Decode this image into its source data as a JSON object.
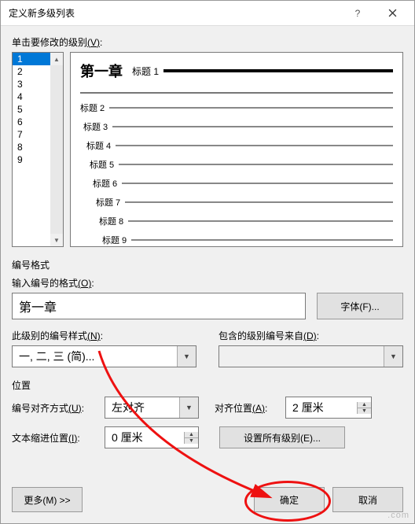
{
  "window": {
    "title": "定义新多级列表"
  },
  "sections": {
    "level_list_label": "单击要修改的级别",
    "level_list_hotkey": "(V)",
    "number_format_label": "编号格式",
    "enter_format_label": "输入编号的格式",
    "enter_format_hotkey": "(O)",
    "style_label": "此级别的编号样式",
    "style_hotkey": "(N)",
    "include_label": "包含的级别编号来自",
    "include_hotkey": "(D)",
    "position_label": "位置",
    "align_label": "编号对齐方式",
    "align_hotkey": "(U)",
    "align_pos_label": "对齐位置",
    "align_pos_hotkey": "(A)",
    "indent_label": "文本缩进位置",
    "indent_hotkey": "(I)"
  },
  "level_list": {
    "items": [
      "1",
      "2",
      "3",
      "4",
      "5",
      "6",
      "7",
      "8",
      "9"
    ],
    "selected_index": 0
  },
  "preview": {
    "main_number": "第一章",
    "main_label": "标题 1",
    "rows": [
      "标题 2",
      "标题 3",
      "标题 4",
      "标题 5",
      "标题 6",
      "标题 7",
      "标题 8",
      "标题 9"
    ]
  },
  "format_input_value": "第一章",
  "font_button": "字体(F)...",
  "style_combo_value": "一, 二, 三 (简)...",
  "include_combo_value": "",
  "align_combo_value": "左对齐",
  "align_pos_value": "2 厘米",
  "indent_value": "0 厘米",
  "set_all_levels_button": "设置所有级别(E)...",
  "more_button": "更多(M) >>",
  "ok_button": "确定",
  "cancel_button": "取消",
  "watermark": ".com"
}
